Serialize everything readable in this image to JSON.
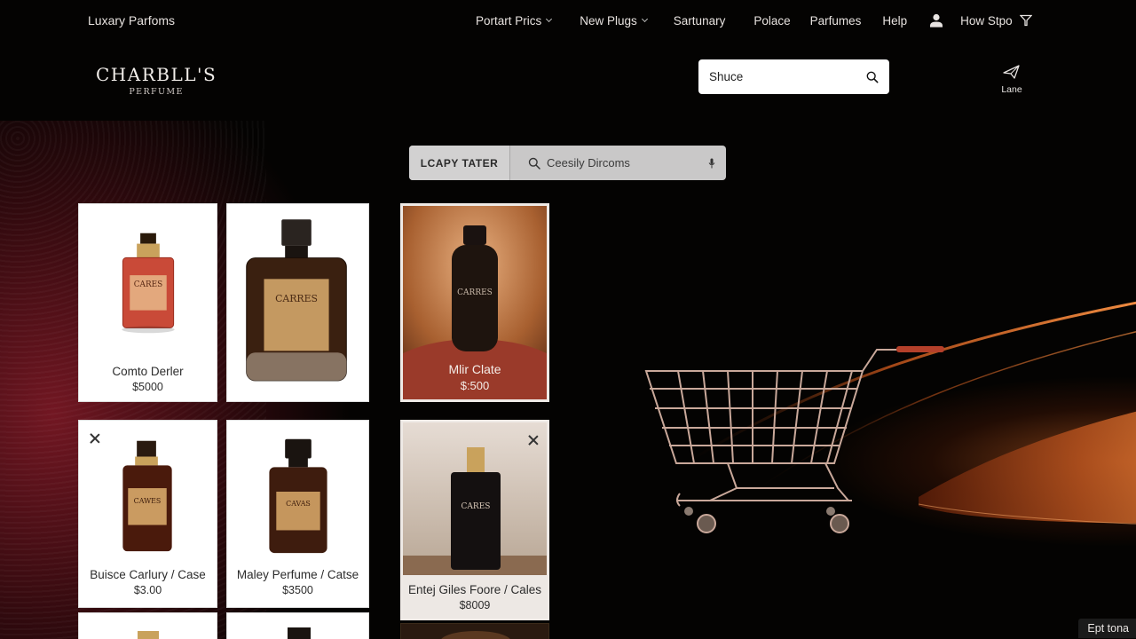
{
  "topbar": {
    "brand": "Luxary Parfoms",
    "nav": [
      {
        "label": "Portart Prics",
        "dropdown": true
      },
      {
        "label": "New Plugs",
        "dropdown": true
      },
      {
        "label": "Sartunary",
        "dropdown": false
      },
      {
        "label": "Polace",
        "dropdown": false
      },
      {
        "label": "Parfumes",
        "dropdown": false
      },
      {
        "label": "Help",
        "dropdown": false
      }
    ],
    "user_icon": "user-icon",
    "shop_label": "How Stpo",
    "filter_icon": "filter-icon"
  },
  "header": {
    "logo_line1": "CHARBLL'S",
    "logo_line2": "PERFUME",
    "search_placeholder": "Shuce",
    "search_icon": "search-icon",
    "lane_label": "Lane",
    "lane_icon": "paper-plane-icon"
  },
  "filterbar": {
    "label": "LCAPY TATER",
    "search_text": "Ceesily Dircoms",
    "search_icon": "search-icon",
    "mic_icon": "mic-icon"
  },
  "products": [
    {
      "name": "Comto Derler",
      "price": "$5000",
      "bottle_label": "CARES"
    },
    {
      "name": "",
      "price": "",
      "bottle_label": "CARRES"
    },
    {
      "name": "Mlir Clate",
      "price": "$:500",
      "bottle_label": "CARRES"
    },
    {
      "name": "Buisce Carlury / Case",
      "price": "$3.00",
      "bottle_label": "CAWES"
    },
    {
      "name": "Maley Perfume / Catse",
      "price": "$3500",
      "bottle_label": "CAVAS"
    },
    {
      "name": "Entej Giles Foore / Cales",
      "price": "$8009",
      "bottle_label": "CARES"
    }
  ],
  "footer_pill": "Ept tona",
  "colors": {
    "background": "#040302",
    "accent_red": "#7a1824",
    "accent_orange": "#de6e28",
    "card_bg": "#ffffff"
  }
}
